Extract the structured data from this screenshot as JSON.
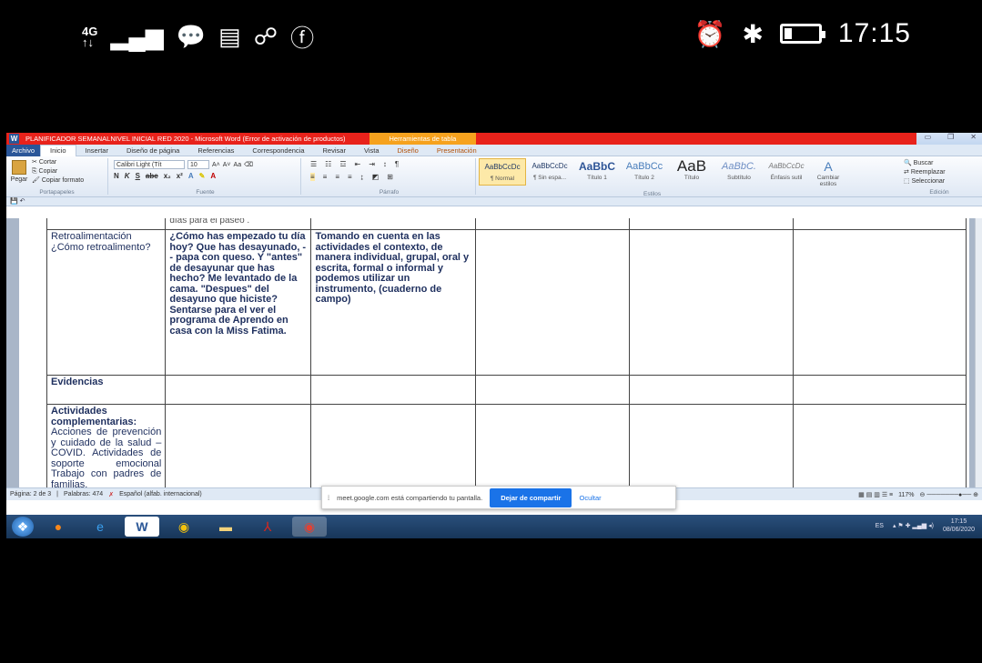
{
  "phone_status": {
    "network": "4G",
    "network_sub": "↑↓",
    "time": "17:15"
  },
  "window": {
    "title": "PLANIFICADOR SEMANALNIVEL INICIAL  RED 2020  -  Microsoft Word (Error de activación de productos)",
    "context_tab": "Herramientas de tabla"
  },
  "menu": {
    "file": "Archivo",
    "tabs": [
      "Inicio",
      "Insertar",
      "Diseño de página",
      "Referencias",
      "Correspondencia",
      "Revisar",
      "Vista",
      "Diseño",
      "Presentación"
    ]
  },
  "ribbon": {
    "clipboard": {
      "paste": "Pegar",
      "cut": "Cortar",
      "copy": "Copiar",
      "format": "Copiar formato",
      "label": "Portapapeles"
    },
    "font": {
      "name": "Calibri Light (Tít",
      "size": "10",
      "label": "Fuente"
    },
    "paragraph": {
      "label": "Párrafo"
    },
    "styles": {
      "label": "Estilos",
      "items": [
        {
          "preview": "AaBbCcDc",
          "name": "¶ Normal"
        },
        {
          "preview": "AaBbCcDc",
          "name": "¶ Sin espa..."
        },
        {
          "preview": "AaBbC",
          "name": "Título 1"
        },
        {
          "preview": "AaBbCc",
          "name": "Título 2"
        },
        {
          "preview": "AaB",
          "name": "Título"
        },
        {
          "preview": "AaBbC.",
          "name": "Subtítulo"
        },
        {
          "preview": "AaBbCcDc",
          "name": "Énfasis sutil"
        }
      ],
      "change": "Cambiar estilos"
    },
    "editing": {
      "find": "Buscar",
      "replace": "Reemplazar",
      "select": "Seleccionar",
      "label": "Edición"
    }
  },
  "document": {
    "top_fragment": "días para el paseo .",
    "rows": [
      {
        "label": "Retroalimentación ¿Cómo retroalimento?",
        "col2": "¿Cómo has empezado tu día hoy? Que has desayunado, -- papa con queso. Y \"antes\" de desayunar que has hecho? Me levantado de la cama. \"Despues\" del desayuno que hiciste? Sentarse para el ver el programa de Aprendo en casa con la Miss Fatima.",
        "col3": "Tomando en cuenta en las actividades el contexto, de manera individual, grupal, oral y escrita, formal o informal y podemos utilizar un instrumento, (cuaderno de campo)"
      },
      {
        "label": "Evidencias",
        "col2": "",
        "col3": ""
      },
      {
        "label": "Actividades complementarias:",
        "label_rest": "Acciones de prevención y cuidado de la salud – COVID. Actividades de soporte emocional Trabajo con padres de familias.",
        "col2": "",
        "col3": ""
      }
    ]
  },
  "statusbar": {
    "page": "Página: 2 de 3",
    "words": "Palabras: 474",
    "language": "Español (alfab. internacional)",
    "zoom": "117%"
  },
  "share_bar": {
    "message": "meet.google.com está compartiendo tu pantalla.",
    "stop": "Dejar de compartir",
    "hide": "Ocultar"
  },
  "taskbar": {
    "lang": "ES",
    "time": "17:15",
    "date": "08/06/2020"
  }
}
